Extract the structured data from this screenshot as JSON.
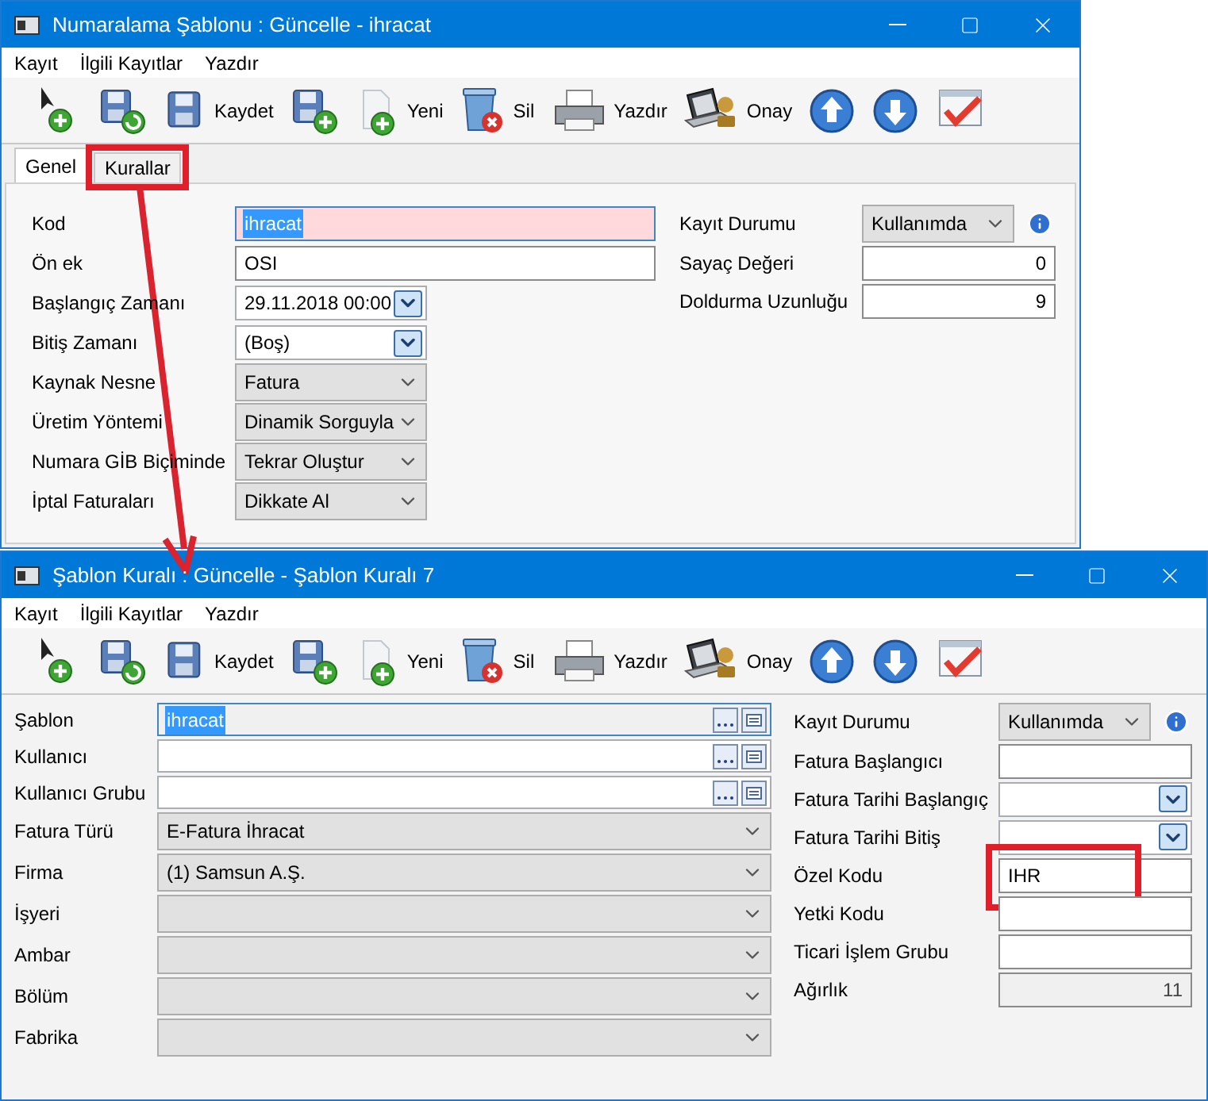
{
  "windows": [
    {
      "title": "Numaralama Şablonu : Güncelle - ihracat",
      "menu": [
        "Kayıt",
        "İlgili Kayıtlar",
        "Yazdır"
      ],
      "toolbar": [
        {
          "kind": "new"
        },
        {
          "kind": "save-refresh"
        },
        {
          "kind": "save",
          "label": "Kaydet"
        },
        {
          "kind": "save-new"
        },
        {
          "kind": "doc",
          "label": "Yeni"
        },
        {
          "kind": "delete",
          "label": "Sil"
        },
        {
          "kind": "print",
          "label": "Yazdır"
        },
        {
          "kind": "approve",
          "label": "Onay"
        },
        {
          "kind": "up"
        },
        {
          "kind": "down"
        },
        {
          "kind": "check"
        }
      ],
      "tabs": [
        {
          "label": "Genel",
          "selected": true,
          "highlighted": false
        },
        {
          "label": "Kurallar",
          "selected": false,
          "highlighted": true
        }
      ],
      "left_fields": [
        {
          "label": "Kod",
          "kind": "text",
          "value": "ihracat",
          "required": true,
          "text_selected": true,
          "disabled": false,
          "highlighted": false
        },
        {
          "label": "Ön ek",
          "kind": "text",
          "value": "OSI",
          "required": false,
          "text_selected": false,
          "disabled": false,
          "highlighted": false
        },
        {
          "label": "Başlangıç Zamanı",
          "kind": "date",
          "value": "29.11.2018 00:00",
          "required": false,
          "text_selected": false,
          "disabled": false,
          "highlighted": false
        },
        {
          "label": "Bitiş Zamanı",
          "kind": "date",
          "value": "(Boş)",
          "required": false,
          "text_selected": false,
          "disabled": false,
          "highlighted": false
        },
        {
          "label": "Kaynak Nesne",
          "kind": "select",
          "value": "Fatura",
          "required": false,
          "text_selected": false,
          "disabled": false,
          "highlighted": false
        },
        {
          "label": "Üretim Yöntemi",
          "kind": "select",
          "value": "Dinamik Sorguyla",
          "required": false,
          "text_selected": false,
          "disabled": false,
          "highlighted": false
        },
        {
          "label": "Numara GİB Biçiminde",
          "kind": "select",
          "value": "Tekrar Oluştur",
          "required": false,
          "text_selected": false,
          "disabled": false,
          "highlighted": false
        },
        {
          "label": "İptal Faturaları",
          "kind": "select",
          "value": "Dikkate Al",
          "required": false,
          "text_selected": false,
          "disabled": false,
          "highlighted": false
        }
      ],
      "right_fields": [
        {
          "label": "Kayıt Durumu",
          "kind": "status",
          "value": "Kullanımda",
          "required": false,
          "text_selected": false,
          "disabled": false,
          "highlighted": false
        },
        {
          "label": "Sayaç Değeri",
          "kind": "number",
          "value": "0",
          "required": false,
          "text_selected": false,
          "disabled": false,
          "highlighted": false
        },
        {
          "label": "Doldurma Uzunluğu",
          "kind": "number",
          "value": "9",
          "required": false,
          "text_selected": false,
          "disabled": false,
          "highlighted": false
        }
      ]
    },
    {
      "title": "Şablon Kuralı : Güncelle - Şablon Kuralı 7",
      "menu": [
        "Kayıt",
        "İlgili Kayıtlar",
        "Yazdır"
      ],
      "toolbar": [
        {
          "kind": "new"
        },
        {
          "kind": "save-refresh"
        },
        {
          "kind": "save",
          "label": "Kaydet"
        },
        {
          "kind": "save-new"
        },
        {
          "kind": "doc",
          "label": "Yeni"
        },
        {
          "kind": "delete",
          "label": "Sil"
        },
        {
          "kind": "print",
          "label": "Yazdır"
        },
        {
          "kind": "approve",
          "label": "Onay"
        },
        {
          "kind": "up"
        },
        {
          "kind": "down"
        },
        {
          "kind": "check"
        }
      ],
      "left_fields": [
        {
          "label": "Şablon",
          "kind": "lookup",
          "value": "ihracat",
          "required": false,
          "text_selected": true,
          "disabled": true,
          "highlighted": false
        },
        {
          "label": "Kullanıcı",
          "kind": "lookup",
          "required": false,
          "text_selected": false,
          "disabled": false,
          "highlighted": false
        },
        {
          "label": "Kullanıcı Grubu",
          "kind": "lookup",
          "required": false,
          "text_selected": false,
          "disabled": false,
          "highlighted": false
        },
        {
          "label": "Fatura Türü",
          "kind": "select",
          "value": "E-Fatura İhracat",
          "required": false,
          "text_selected": false,
          "disabled": false,
          "highlighted": false
        },
        {
          "label": "Firma",
          "kind": "select",
          "value": "(1) Samsun A.Ş.",
          "required": false,
          "text_selected": false,
          "disabled": false,
          "highlighted": false
        },
        {
          "label": "İşyeri",
          "kind": "select",
          "required": false,
          "text_selected": false,
          "disabled": false,
          "highlighted": false
        },
        {
          "label": "Ambar",
          "kind": "select",
          "required": false,
          "text_selected": false,
          "disabled": false,
          "highlighted": false
        },
        {
          "label": "Bölüm",
          "kind": "select",
          "required": false,
          "text_selected": false,
          "disabled": false,
          "highlighted": false
        },
        {
          "label": "Fabrika",
          "kind": "select",
          "required": false,
          "text_selected": false,
          "disabled": false,
          "highlighted": false
        }
      ],
      "right_fields": [
        {
          "label": "Kayıt Durumu",
          "kind": "status",
          "value": "Kullanımda",
          "required": false,
          "text_selected": false,
          "disabled": false,
          "highlighted": false
        },
        {
          "label": "Fatura Başlangıcı",
          "kind": "text",
          "required": false,
          "text_selected": false,
          "disabled": false,
          "highlighted": false
        },
        {
          "label": "Fatura Tarihi Başlangıç",
          "kind": "date",
          "required": false,
          "text_selected": false,
          "disabled": false,
          "highlighted": false
        },
        {
          "label": "Fatura Tarihi Bitiş",
          "kind": "date",
          "required": false,
          "text_selected": false,
          "disabled": false,
          "highlighted": false
        },
        {
          "label": "Özel Kodu",
          "kind": "text",
          "value": "IHR",
          "required": false,
          "text_selected": false,
          "disabled": false,
          "highlighted": true
        },
        {
          "label": "Yetki Kodu",
          "kind": "text",
          "required": false,
          "text_selected": false,
          "disabled": false,
          "highlighted": false
        },
        {
          "label": "Ticari İşlem Grubu",
          "kind": "text",
          "required": false,
          "text_selected": false,
          "disabled": false,
          "highlighted": false
        },
        {
          "label": "Ağırlık",
          "kind": "number",
          "value": "11",
          "required": false,
          "text_selected": false,
          "disabled": true,
          "highlighted": false
        }
      ]
    }
  ]
}
